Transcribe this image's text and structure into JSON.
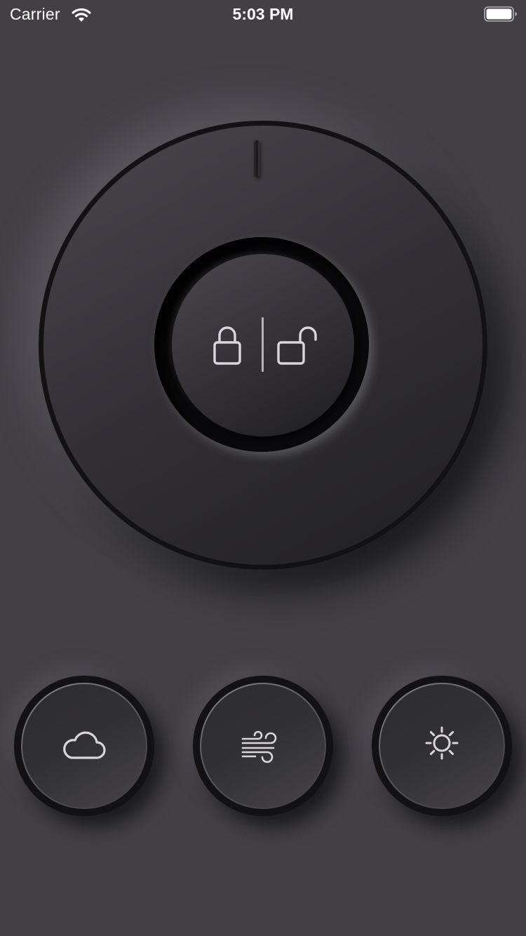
{
  "status_bar": {
    "carrier": "Carrier",
    "time": "5:03 PM",
    "wifi_icon": "wifi-icon",
    "battery_icon": "battery-full-icon"
  },
  "dial": {
    "control": "lock-unlock-dial",
    "lock_icon": "lock-icon",
    "unlock_icon": "unlock-icon",
    "marker": "position-marker"
  },
  "buttons": [
    {
      "id": "cloud",
      "icon": "cloud-icon"
    },
    {
      "id": "wind",
      "icon": "wind-icon"
    },
    {
      "id": "sun",
      "icon": "sun-icon"
    }
  ],
  "colors": {
    "background": "#424045",
    "dial_rim": "#121114",
    "icon_stroke": "#d9d7dc"
  }
}
